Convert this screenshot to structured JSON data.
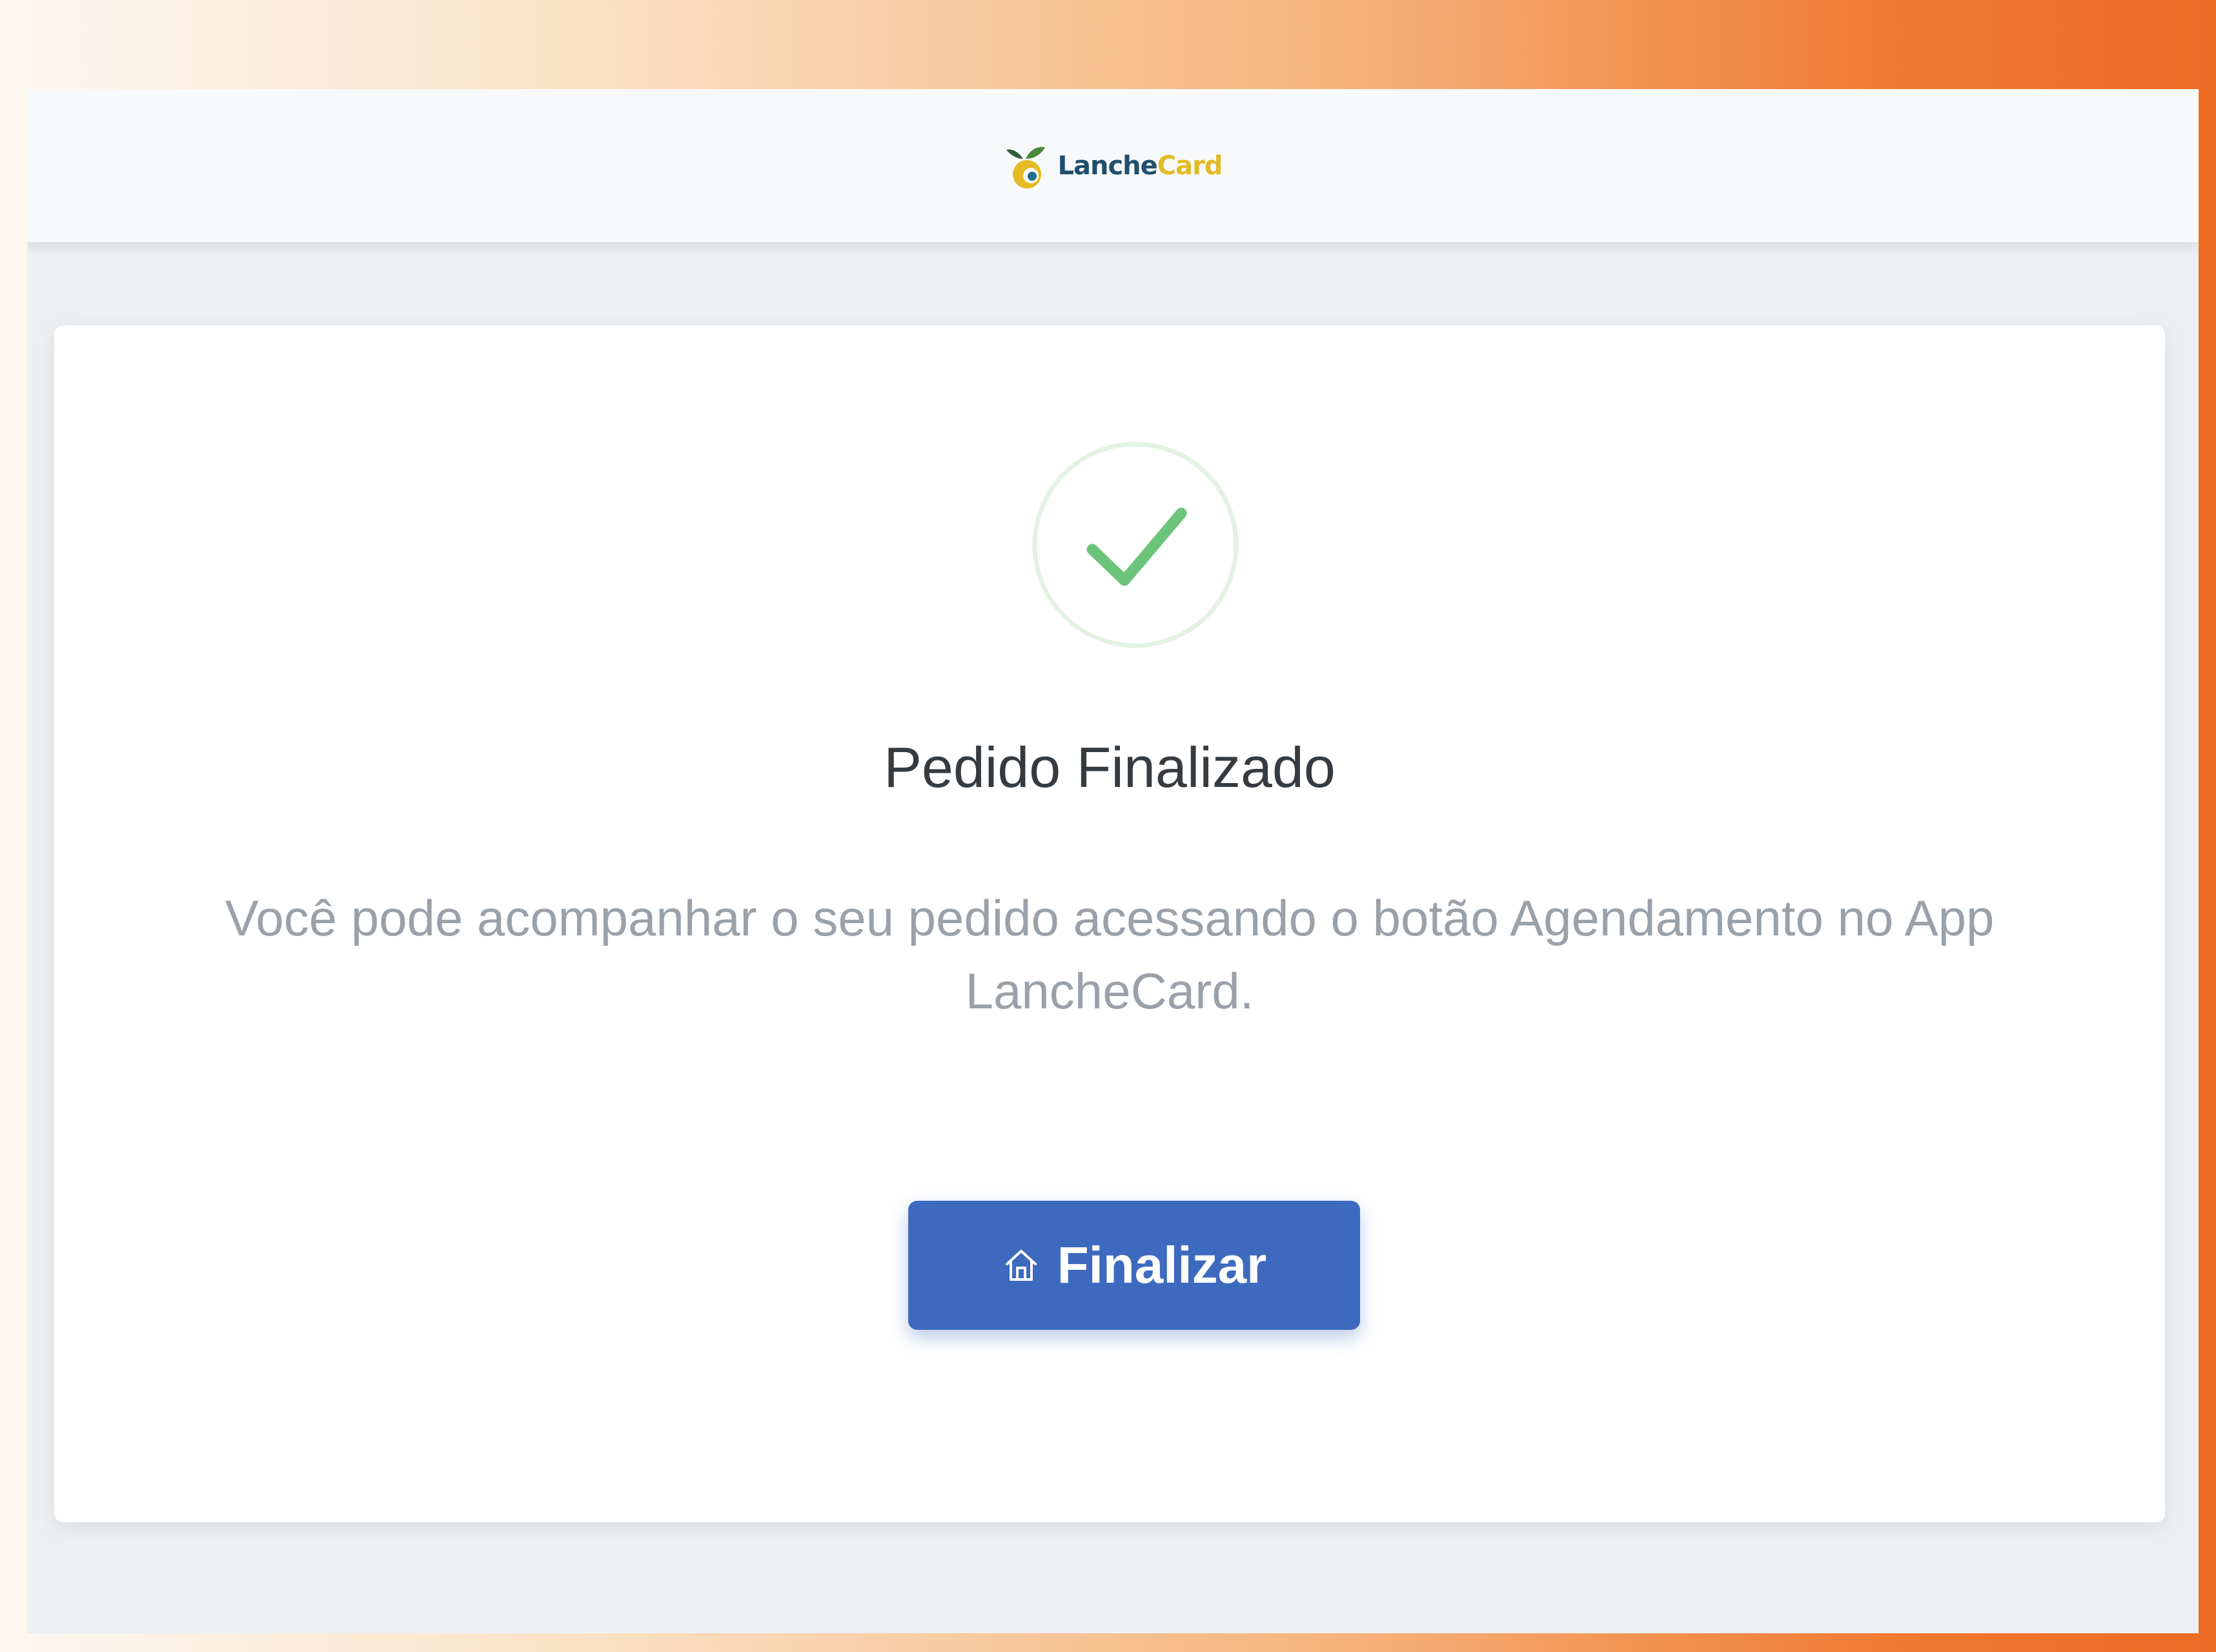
{
  "header": {
    "logo_primary": "Lanche",
    "logo_secondary": "Card",
    "logo_icon": "lanchecard-logo-icon"
  },
  "confirmation": {
    "icon": "success-check-icon",
    "title": "Pedido Finalizado",
    "message": "Você pode acompanhar o seu pedido acessando o botão Agendamento no App LancheCard."
  },
  "actions": {
    "finalize_icon": "home-icon",
    "finalize_label": "Finalizar"
  },
  "colors": {
    "accent_blue": "#3d6abe",
    "success_green": "#6cc47a",
    "logo_navy": "#1f4f6e",
    "logo_yellow": "#e3bb24",
    "frame_orange": "#ed6a23"
  }
}
